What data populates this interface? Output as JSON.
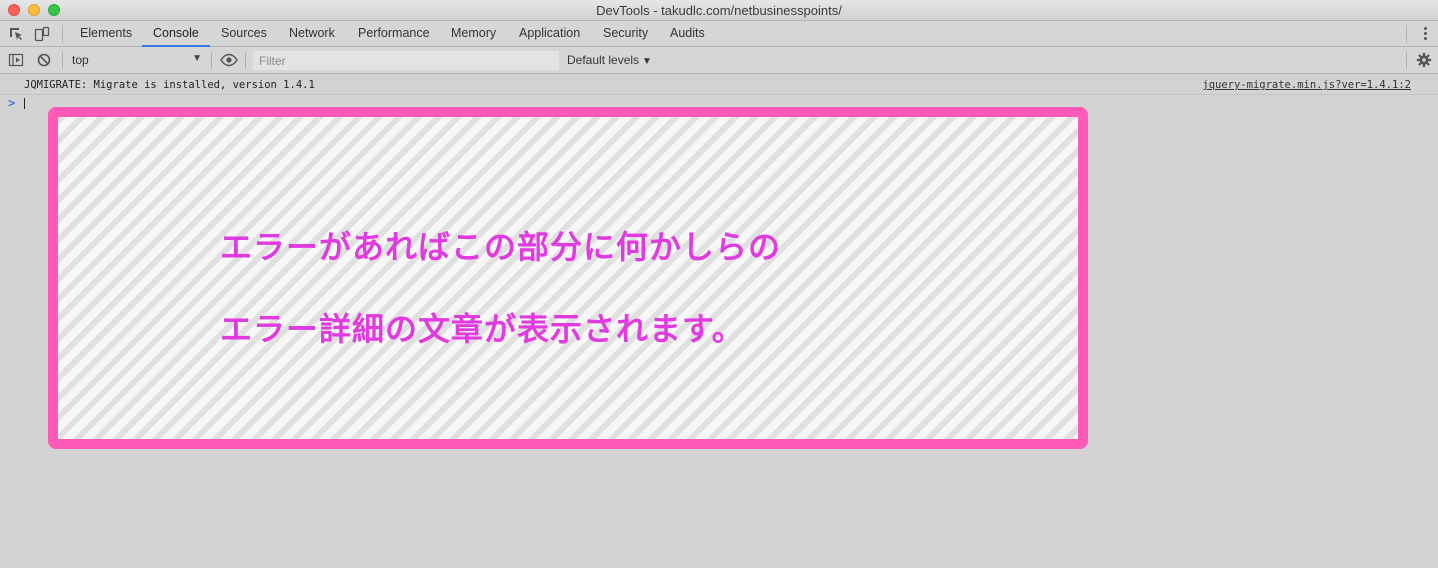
{
  "window": {
    "title": "DevTools - takudlc.com/netbusinesspoints/"
  },
  "tabs": [
    {
      "label": "Elements"
    },
    {
      "label": "Console"
    },
    {
      "label": "Sources"
    },
    {
      "label": "Network"
    },
    {
      "label": "Performance"
    },
    {
      "label": "Memory"
    },
    {
      "label": "Application"
    },
    {
      "label": "Security"
    },
    {
      "label": "Audits"
    }
  ],
  "active_tab": "Console",
  "toolbar": {
    "context": "top",
    "filter_placeholder": "Filter",
    "levels": "Default levels"
  },
  "console": {
    "messages": [
      {
        "text": "JQMIGRATE: Migrate is installed, version 1.4.1",
        "source": "jquery-migrate.min.js?ver=1.4.1:2"
      }
    ],
    "prompt": ">"
  },
  "callout": {
    "line1": "エラーがあればこの部分に何かしらの",
    "line2": "エラー詳細の文章が表示されます。"
  },
  "colors": {
    "accent": "#3879d9",
    "callout_border": "#ff5ab8",
    "callout_text": "#e03ae0"
  }
}
